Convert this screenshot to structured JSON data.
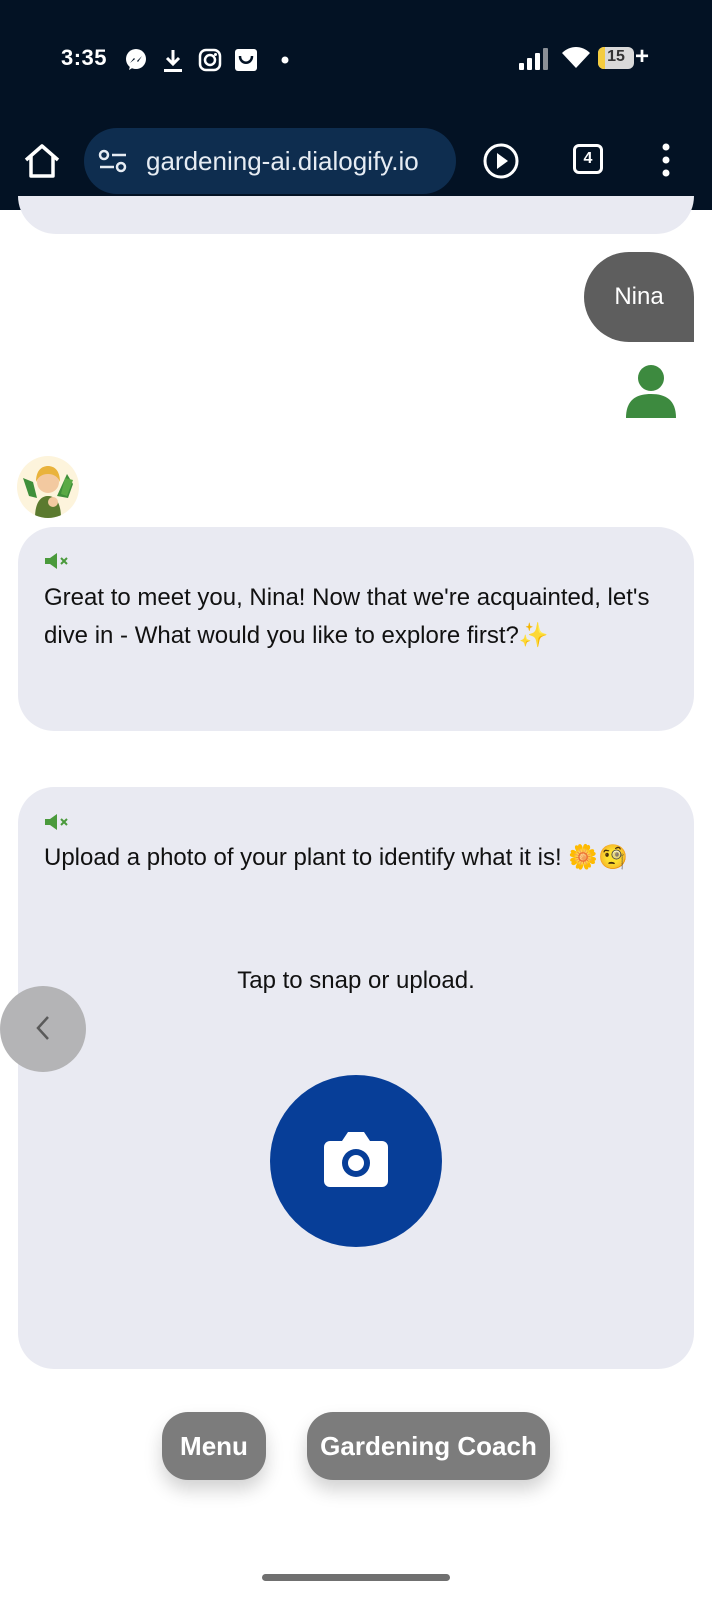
{
  "status_bar": {
    "time": "3:35",
    "icons": [
      "messenger-icon",
      "download-icon",
      "instagram-icon",
      "shopping-bag-icon",
      "dot-icon",
      "signal-icon",
      "wifi-icon"
    ],
    "battery": "15",
    "charging": "+"
  },
  "browser": {
    "url": "gardening-ai.dialogify.io",
    "tab_count": "4",
    "colors": {
      "bar": "#031224",
      "url_pill": "#0e2d4f"
    }
  },
  "chat": {
    "user_message": "Nina",
    "bot_message_1": "Great to meet you, Nina! Now that we're acquainted, let's dive in - What would you like to explore first?✨",
    "bot_message_2": "Upload a photo of your plant to identify what it is! 🌼🧐",
    "upload_hint": "Tap to snap or upload.",
    "colors": {
      "bubble": "#e9eaf2",
      "user_bubble": "#5e5e5e",
      "camera_button": "#073e98",
      "user_icon": "#3d8a3f"
    }
  },
  "bottom_buttons": {
    "menu": "Menu",
    "coach": "Gardening Coach"
  }
}
